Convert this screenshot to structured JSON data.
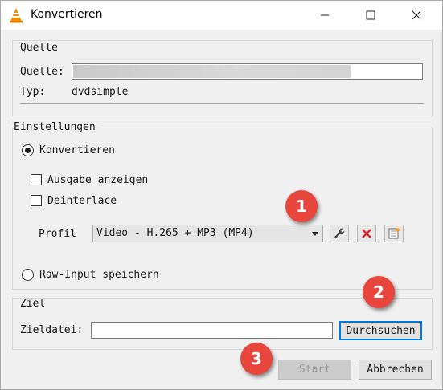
{
  "window": {
    "title": "Konvertieren"
  },
  "source": {
    "group_title": "Quelle",
    "label": "Quelle:",
    "type_label": "Typ:",
    "type_value": "dvdsimple"
  },
  "settings": {
    "group_title": "Einstellungen",
    "convert_label": "Konvertieren",
    "convert_selected": true,
    "show_output_label": "Ausgabe anzeigen",
    "show_output_checked": false,
    "deinterlace_label": "Deinterlace",
    "deinterlace_checked": false,
    "profile_label": "Profil",
    "profile_value": "Video - H.265 + MP3 (MP4)",
    "raw_label": "Raw-Input speichern",
    "raw_selected": false
  },
  "destination": {
    "group_title": "Ziel",
    "file_label": "Zieldatei:",
    "file_value": "",
    "browse_label": "Durchsuchen"
  },
  "buttons": {
    "start": "Start",
    "cancel": "Abbrechen"
  },
  "markers": [
    "1",
    "2",
    "3"
  ],
  "colors": {
    "marker": "#e8453c",
    "accent": "#0078d7",
    "delete_icon": "#d9262d"
  }
}
